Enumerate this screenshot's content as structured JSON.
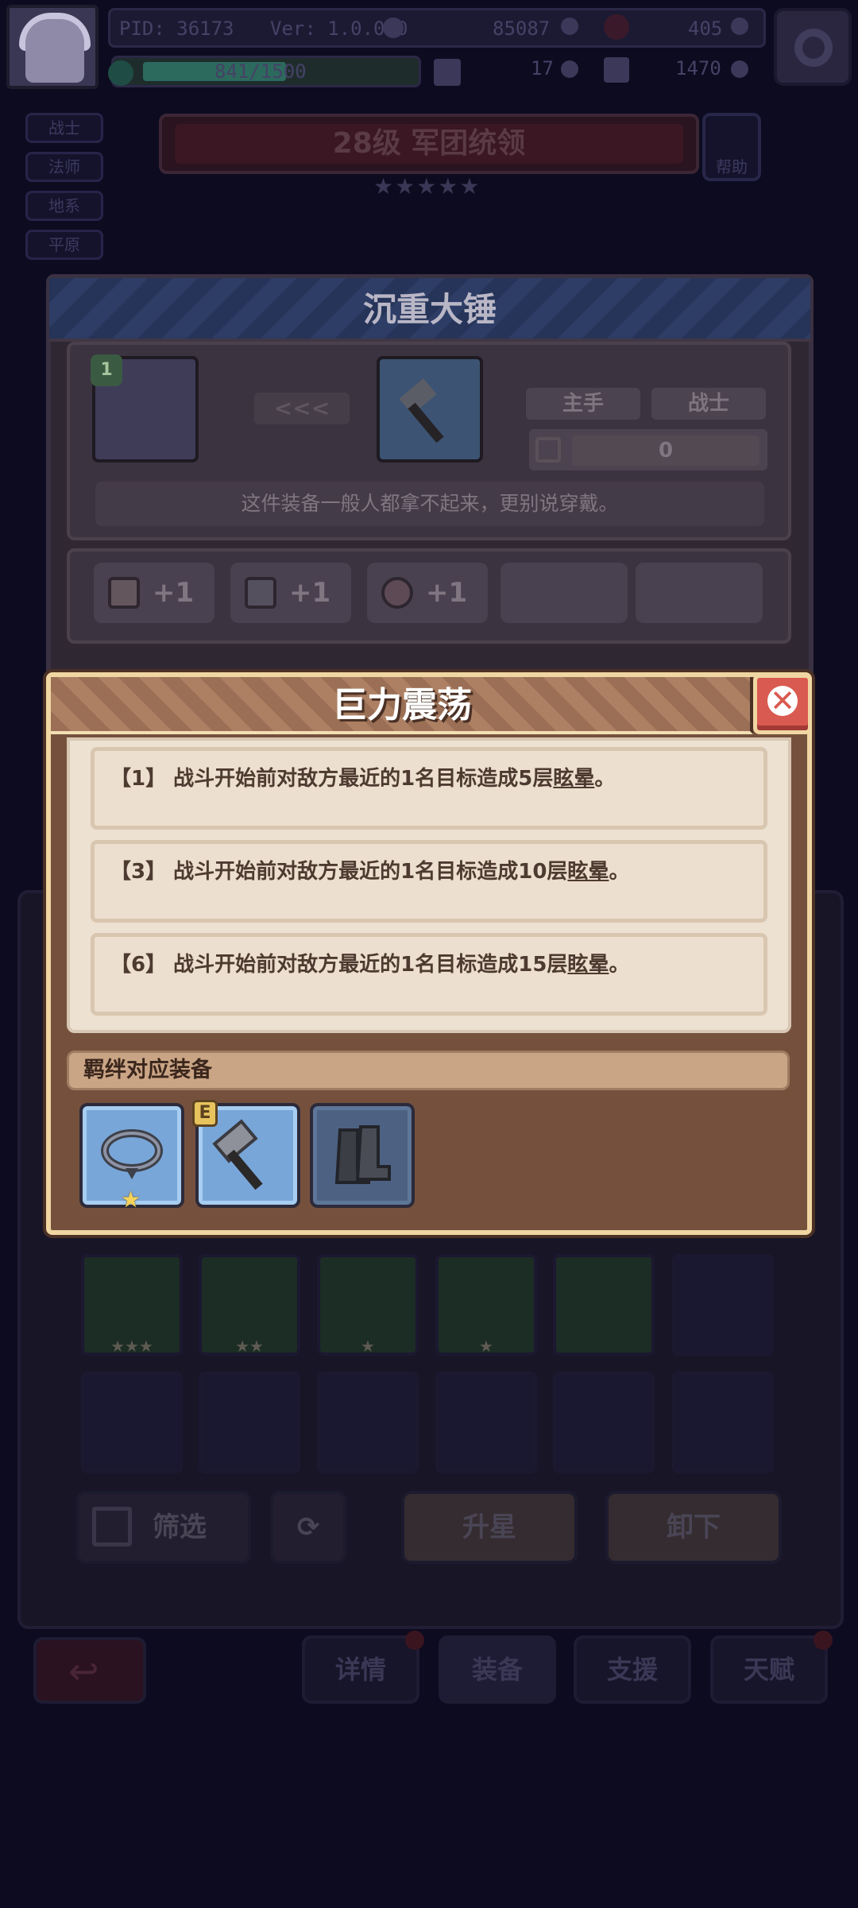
{
  "header": {
    "pid": "PID: 36173",
    "version": "Ver: 1.0.0.0",
    "gold": "85087",
    "gems": "405",
    "xp": "841/1500",
    "keys": "17",
    "shards": "1470"
  },
  "side_tabs": [
    "战士",
    "法师",
    "地系",
    "平原"
  ],
  "rank": {
    "title": "28级 军团统领",
    "help_label": "帮助",
    "stars": "★★★★★"
  },
  "item": {
    "name": "沉重大锤",
    "level_badge": "1",
    "arrows": "<<<",
    "slot_tag": "主手",
    "class_tag": "战士",
    "power_value": "0",
    "description": "这件装备一般人都拿不起来，更别说穿戴。",
    "stats": [
      "+1",
      "+1",
      "+1"
    ]
  },
  "popup": {
    "title": "巨力震荡",
    "close_icon": "close-icon",
    "effects": [
      {
        "prefix": "【1】 战斗开始前对敌方最近的1名目标造成5层",
        "keyword": "眩晕",
        "suffix": "。"
      },
      {
        "prefix": "【3】 战斗开始前对敌方最近的1名目标造成10层",
        "keyword": "眩晕",
        "suffix": "。"
      },
      {
        "prefix": "【6】 战斗开始前对敌方最近的1名目标造成15层",
        "keyword": "眩晕",
        "suffix": "。"
      }
    ],
    "bond_header": "羁绊对应装备",
    "bond_items": [
      {
        "icon": "collar-icon",
        "badge_star": "★"
      },
      {
        "icon": "hammer-icon",
        "badge": "E"
      },
      {
        "icon": "boots-icon"
      }
    ]
  },
  "inventory": {
    "row1_stars": [
      "★★★",
      "★★",
      "★",
      "★",
      ""
    ],
    "buttons": {
      "filter": "筛选",
      "upgrade": "升星",
      "unequip": "卸下"
    }
  },
  "bottom_nav": {
    "tabs": [
      "详情",
      "装备",
      "支援",
      "天赋"
    ]
  },
  "colors": {
    "popup_bg": "#75513d",
    "popup_border": "#f0d6a2",
    "close_red": "#d95a50",
    "effect_text": "#4d3a30",
    "bond_slot_blue": "#79a6d8"
  }
}
